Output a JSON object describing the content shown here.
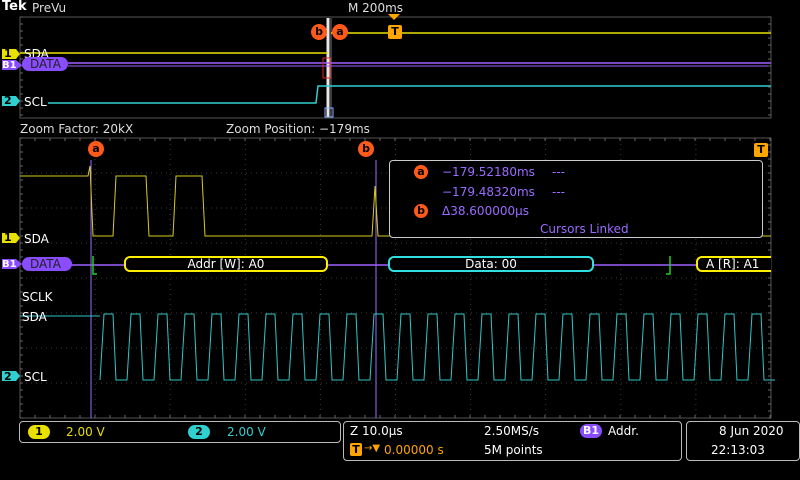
{
  "header": {
    "brand": "Tek",
    "mode": "PreVu",
    "timebase": "M 200ms",
    "trigger_marker": "T"
  },
  "overview": {
    "ch1_number": "1",
    "ch1_label": "SDA",
    "bus_badge": "B1",
    "bus_label": "DATA",
    "ch2_number": "2",
    "ch2_label": "SCL",
    "cursor_b_marker": "b",
    "cursor_a_marker": "a"
  },
  "zoom_info": {
    "zoom_factor": "Zoom Factor: 20kX",
    "zoom_position": "Zoom Position: −179ms"
  },
  "main": {
    "cursor_a_marker": "a",
    "cursor_b_marker": "b",
    "trigger_marker": "T",
    "ch1_number": "1",
    "ch1_label": "SDA",
    "bus_badge": "B1",
    "bus_label": "DATA",
    "decode_packets": [
      {
        "text": "Addr [W]: A0",
        "color": "#ffee00"
      },
      {
        "text": "Data: 00",
        "color": "#30e0e0"
      },
      {
        "text": "A [R]: A1",
        "color": "#ffee00"
      }
    ],
    "sclk_label": "SCLK",
    "sda_label": "SDA",
    "ch2_number": "2",
    "ch2_label": "SCL"
  },
  "cursor_readout": {
    "a_marker": "a",
    "a_time": "−179.52180ms",
    "a_value": "---",
    "second_time": "−179.48320ms",
    "second_value": "---",
    "b_marker": "b",
    "delta": "Δ38.600000µs",
    "linked": "Cursors Linked"
  },
  "status_bar": {
    "ch1_number": "1",
    "ch1_scale": "2.00 V",
    "ch2_number": "2",
    "ch2_scale": "2.00 V",
    "zoom_scale": "Z 10.0µs",
    "sample_rate": "2.50MS/s",
    "bus_badge": "B1",
    "bus_trigger": "Addr.",
    "trigger_marker": "T",
    "trigger_offset": "0.00000 s",
    "record_length": "5M points",
    "date": "8 Jun  2020",
    "time": "22:13:03"
  },
  "colors": {
    "ch1": "#e8e000",
    "ch2": "#30d0d0",
    "bus": "#a060ff",
    "cursor": "#9a6cff",
    "marker": "#ff5a1a",
    "trigger": "#ffa500"
  }
}
